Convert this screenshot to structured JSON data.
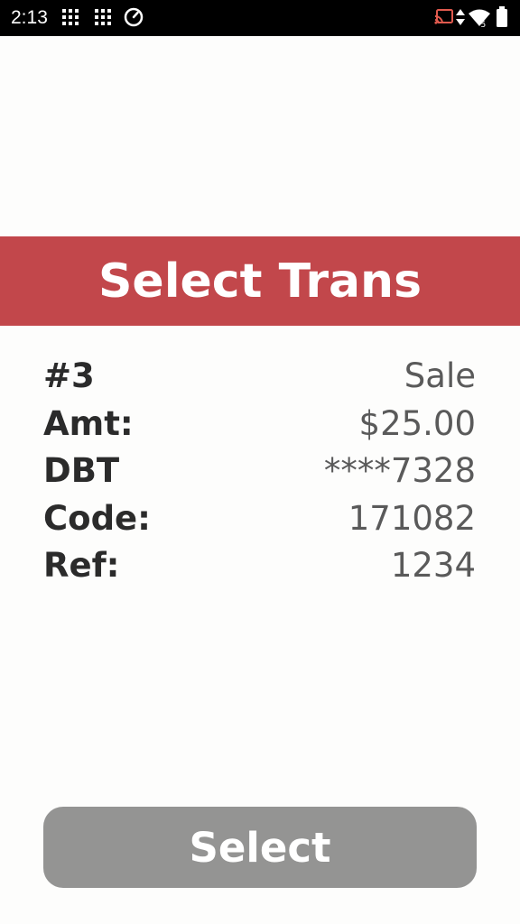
{
  "status_bar": {
    "time": "2:13",
    "icons": [
      "grid-icon",
      "grid-icon",
      "gauge-icon",
      "cast-icon",
      "data-arrows-icon",
      "wifi-icon",
      "battery-icon"
    ],
    "wifi_badge": "5"
  },
  "header": {
    "title": "Select Trans",
    "color": "#c2474b"
  },
  "transaction": {
    "rows": [
      {
        "label": "#3",
        "value": "Sale"
      },
      {
        "label": "Amt:",
        "value": "$25.00"
      },
      {
        "label": "DBT",
        "value": "****7328"
      },
      {
        "label": "Code:",
        "value": "171082"
      },
      {
        "label": "Ref:",
        "value": "1234"
      }
    ]
  },
  "actions": {
    "select_label": "Select",
    "button_color": "#949493"
  }
}
